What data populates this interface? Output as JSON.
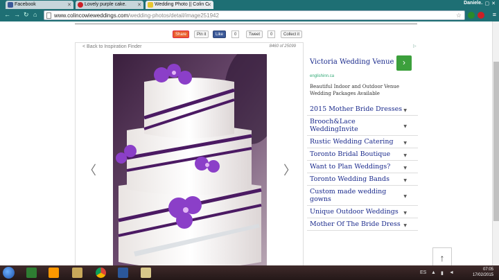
{
  "browser": {
    "tabs": [
      {
        "label": "Facebook",
        "favicon_color": "#3b5998"
      },
      {
        "label": "Lovely purple cake.",
        "favicon_color": "#cb2027"
      },
      {
        "label": "Wedding Photo || Colin C",
        "favicon_color": "#e8c830"
      }
    ],
    "user": "Daniele",
    "url_host": "www.colincowieweddings.com",
    "url_path": "/wedding-photos/detail/image251942"
  },
  "share_bar": {
    "share_label": "Share",
    "pin_label": "Pin it",
    "like_label": "Like",
    "like_count": "0",
    "tweet_label": "Tweet",
    "tweet_count": "0",
    "collect_label": "Collect it"
  },
  "gallery": {
    "back_link": "< Back to Inspiration Finder",
    "counter": "8460  of  25099",
    "prev_arrow": "〈",
    "next_arrow": "〉"
  },
  "ad": {
    "title": "Victoria Wedding Venue",
    "go_glyph": "›",
    "domain": "englishinn.ca",
    "description": "Beautiful Indoor and Outdoor Venue Wedding Packages Available"
  },
  "ad_links": [
    "2015 Mother Bride Dresses",
    "Brooch&Lace WeddingInvite",
    "Rustic Wedding Catering",
    "Toronto Bridal Boutique",
    "Want to Plan Weddings?",
    "Toronto Wedding Bands",
    "Custom made wedding gowns",
    "Unique Outdoor Weddings",
    "Mother Of The Bride Dress"
  ],
  "scroll_top_glyph": "↑",
  "taskbar": {
    "lang": "ES",
    "time": "07:05",
    "date": "17/02/2015"
  }
}
